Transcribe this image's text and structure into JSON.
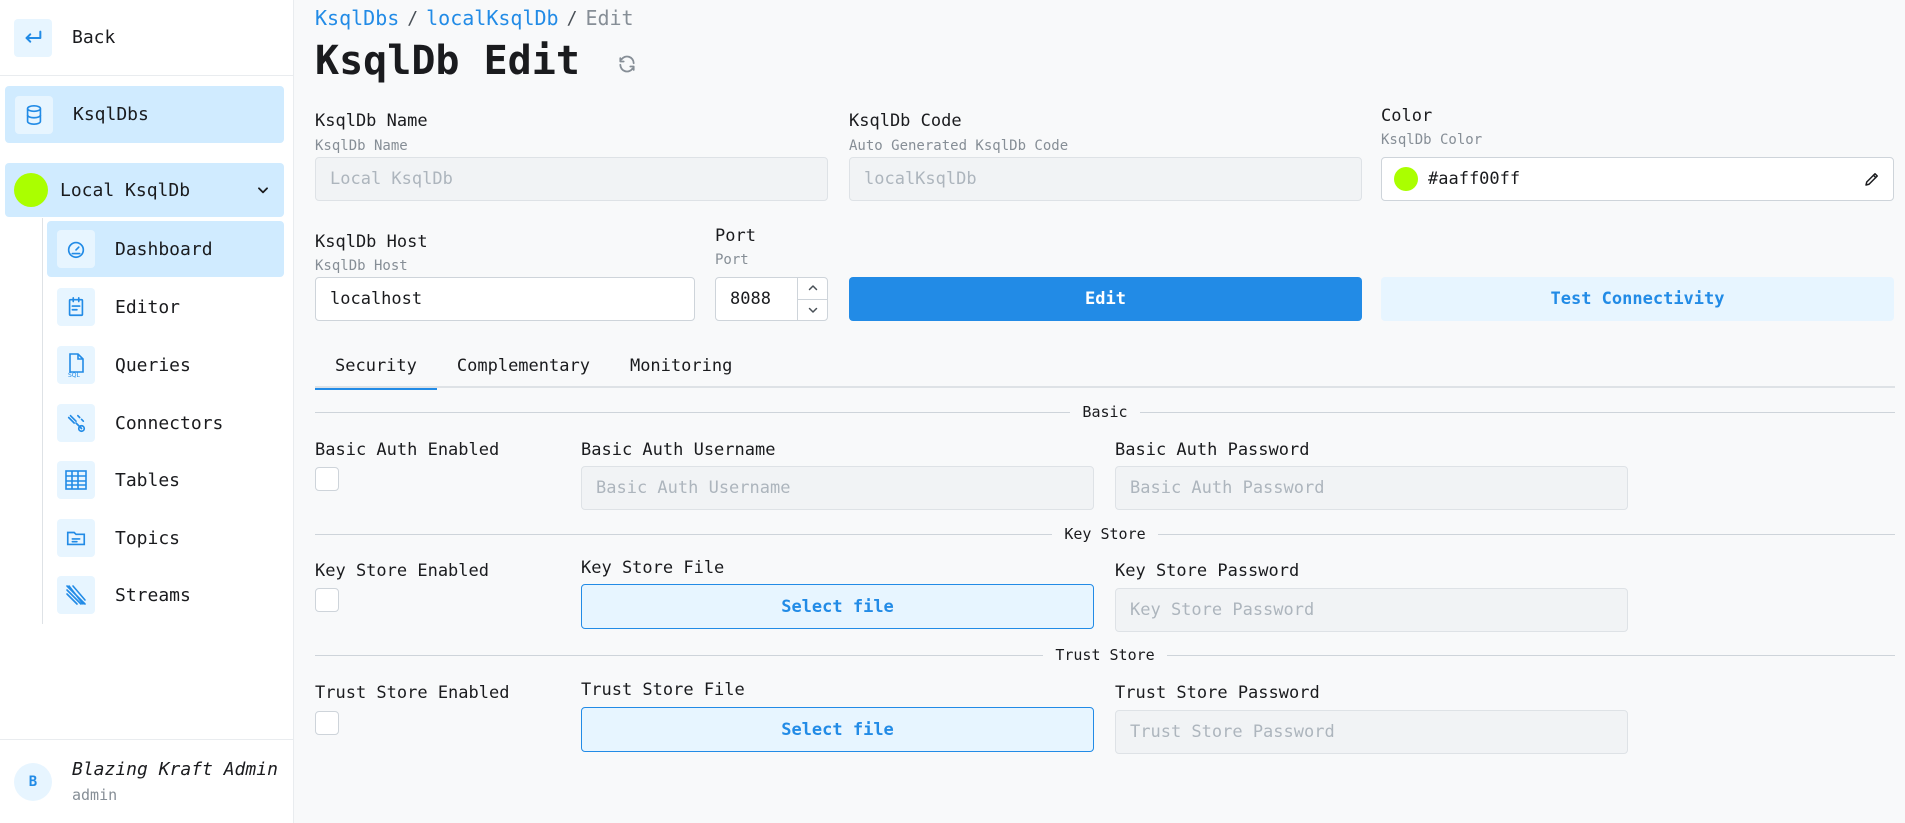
{
  "sidebar": {
    "back_label": "Back",
    "ksqldbs_label": "KsqlDbs",
    "current_ksqldb": {
      "name": "Local KsqlDb",
      "color": "#aaff00"
    },
    "nav": [
      {
        "label": "Dashboard",
        "icon": "gauge-icon",
        "active": true
      },
      {
        "label": "Editor",
        "icon": "editor-icon"
      },
      {
        "label": "Queries",
        "icon": "sql-file-icon"
      },
      {
        "label": "Connectors",
        "icon": "connectors-icon"
      },
      {
        "label": "Tables",
        "icon": "table-icon"
      },
      {
        "label": "Topics",
        "icon": "topics-icon"
      },
      {
        "label": "Streams",
        "icon": "streams-icon"
      }
    ],
    "user": {
      "initial": "B",
      "name": "Blazing Kraft Admin",
      "role": "admin"
    }
  },
  "breadcrumb": {
    "root": "KsqlDbs",
    "item": "localKsqlDb",
    "current": "Edit",
    "separator": "/"
  },
  "page_title": "KsqlDb Edit",
  "form": {
    "name": {
      "label": "KsqlDb Name",
      "description": "KsqlDb Name",
      "value": "Local KsqlDb"
    },
    "code": {
      "label": "KsqlDb Code",
      "description": "Auto Generated KsqlDb Code",
      "value": "localKsqlDb"
    },
    "color": {
      "label": "Color",
      "description": "KsqlDb Color",
      "value": "#aaff00ff"
    },
    "host": {
      "label": "KsqlDb Host",
      "description": "KsqlDb Host",
      "value": "localhost"
    },
    "port": {
      "label": "Port",
      "description": "Port",
      "value": "8088"
    },
    "edit_button": "Edit",
    "test_button": "Test Connectivity"
  },
  "tabs": [
    {
      "label": "Security",
      "active": true
    },
    {
      "label": "Complementary"
    },
    {
      "label": "Monitoring"
    }
  ],
  "security": {
    "basic": {
      "section": "Basic",
      "enabled_label": "Basic Auth Enabled",
      "username_label": "Basic Auth Username",
      "username_placeholder": "Basic Auth Username",
      "password_label": "Basic Auth Password",
      "password_placeholder": "Basic Auth Password"
    },
    "key_store": {
      "section": "Key Store",
      "enabled_label": "Key Store Enabled",
      "file_label": "Key Store File",
      "file_button": "Select file",
      "password_label": "Key Store Password",
      "password_placeholder": "Key Store Password"
    },
    "trust_store": {
      "section": "Trust Store",
      "enabled_label": "Trust Store Enabled",
      "file_label": "Trust Store File",
      "file_button": "Select file",
      "password_label": "Trust Store Password",
      "password_placeholder": "Trust Store Password"
    }
  },
  "colors": {
    "accent": "#228be6",
    "accent_light": "#e7f5ff",
    "active_bg": "#d0ebff"
  }
}
